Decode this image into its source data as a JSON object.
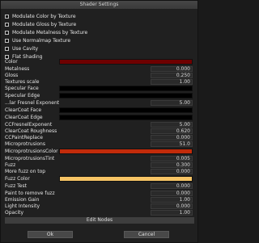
{
  "window": {
    "title": "Shader Settings"
  },
  "checkboxes": [
    "Modulate Color by Texture",
    "Modulate Gloss by Texture",
    "Modulate Metalness by Texture",
    "Use Normalmap Texture",
    "Use Cavity",
    "Flat Shading"
  ],
  "rows": {
    "color": "Color",
    "metalness": {
      "label": "Metalness",
      "value": "0.000"
    },
    "gloss": {
      "label": "Gloss",
      "value": "0.250"
    },
    "textures_scale": {
      "label": "Textures scale",
      "value": "1.00"
    },
    "specular_face": "Specular Face",
    "specular_edge": "Specular Edge",
    "fresnel_exponent": {
      "label": "...lar Fresnel Exponent",
      "value": "5.00"
    },
    "clearcoat_face": "ClearCoat Face",
    "clearcoat_edge": "ClearCoat Edge",
    "ccfresnel": {
      "label": "CCFresnelExponent",
      "value": "5.00"
    },
    "cc_roughness": {
      "label": "ClearCoat Roughness",
      "value": "0.620"
    },
    "ccpaint_replace": {
      "label": "CCPaintReplace",
      "value": "0.000"
    },
    "microprotrusions": {
      "label": "Microprotrusions",
      "value": "51.0"
    },
    "microprotrusions_color": "MicroprotrusionsColor",
    "microprotrusions_tint": {
      "label": "MicroprotrusionsTint",
      "value": "0.005"
    },
    "fuzz": {
      "label": "Fuzz",
      "value": "0.300"
    },
    "more_fuzz": {
      "label": "More fuzz on top",
      "value": "0.000"
    },
    "fuzz_color": "Fuzz Color",
    "fuzz_test": {
      "label": "Fuzz Test",
      "value": "0.000"
    },
    "paint_remove": {
      "label": "Paint to remove fuzz",
      "value": "0.000"
    },
    "emission_gain": {
      "label": "Emission Gain",
      "value": "1.00"
    },
    "light_intensity": {
      "label": "Light Intensity",
      "value": "0.000"
    },
    "opacity": {
      "label": "Opacity",
      "value": "1.00"
    }
  },
  "colors": {
    "color": "#6e0000",
    "specular_face": "#000000",
    "specular_edge": "#000000",
    "clearcoat_face": "#000000",
    "clearcoat_edge": "#000000",
    "microprotrusions_color": "#c22b0a",
    "fuzz_color": "#f6c465"
  },
  "buttons": {
    "edit_nodes": "Edit Nodes",
    "ok": "Ok",
    "cancel": "Cancel"
  }
}
